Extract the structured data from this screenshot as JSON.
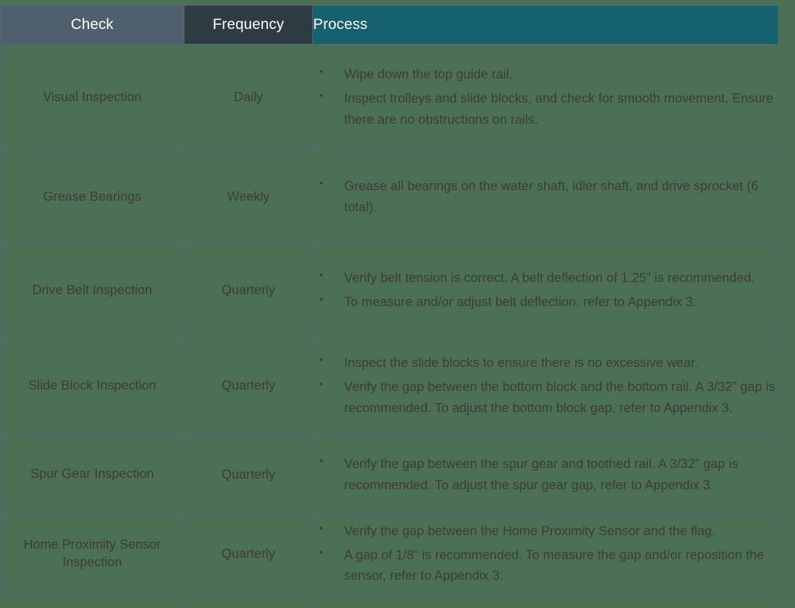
{
  "table": {
    "headers": {
      "check": "Check",
      "frequency": "Frequency",
      "process": "Process"
    },
    "header_colors": {
      "check": "#4f5f6e",
      "frequency": "#2e3b42",
      "process": "#15616d"
    },
    "body_color": "#4c7053",
    "border_color": "#5b6480",
    "text_color": "#3c3c3c",
    "rows": [
      {
        "check": "Visual Inspection",
        "frequency": "Daily",
        "process": [
          "Wipe down the top guide rail.",
          "Inspect trolleys and slide blocks, and check for smooth movement. Ensure there are no obstructions on rails."
        ]
      },
      {
        "check": "Grease Bearings",
        "frequency": "Weekly",
        "process": [
          "Grease all bearings on the water shaft, idler shaft, and drive sprocket (6 total)."
        ]
      },
      {
        "check": "Drive Belt Inspection",
        "frequency": "Quarterly",
        "process": [
          "Verify belt tension is correct. A belt deflection of 1.25” is recommended.",
          "To measure and/or adjust belt deflection, refer to Appendix 3."
        ]
      },
      {
        "check": "Slide Block Inspection",
        "frequency": "Quarterly",
        "process": [
          "Inspect the slide blocks to ensure there is no excessive wear.",
          "Verify the gap between the bottom block and the bottom rail. A 3/32” gap is recommended. To adjust the bottom block gap, refer to Appendix 3."
        ]
      },
      {
        "check": "Spur Gear Inspection",
        "frequency": "Quarterly",
        "process": [
          "Verify the gap between the spur gear and toothed rail. A 3/32” gap is recommended. To adjust the spur gear gap, refer to Appendix 3."
        ]
      },
      {
        "check": "Home Proximity Sensor Inspection",
        "frequency": "Quarterly",
        "process": [
          "Verify the gap between the Home Proximity Sensor and the flag.",
          "A gap of 1/8” is recommended. To measure the gap and/or reposition the sensor, refer to Appendix 3."
        ]
      }
    ]
  }
}
